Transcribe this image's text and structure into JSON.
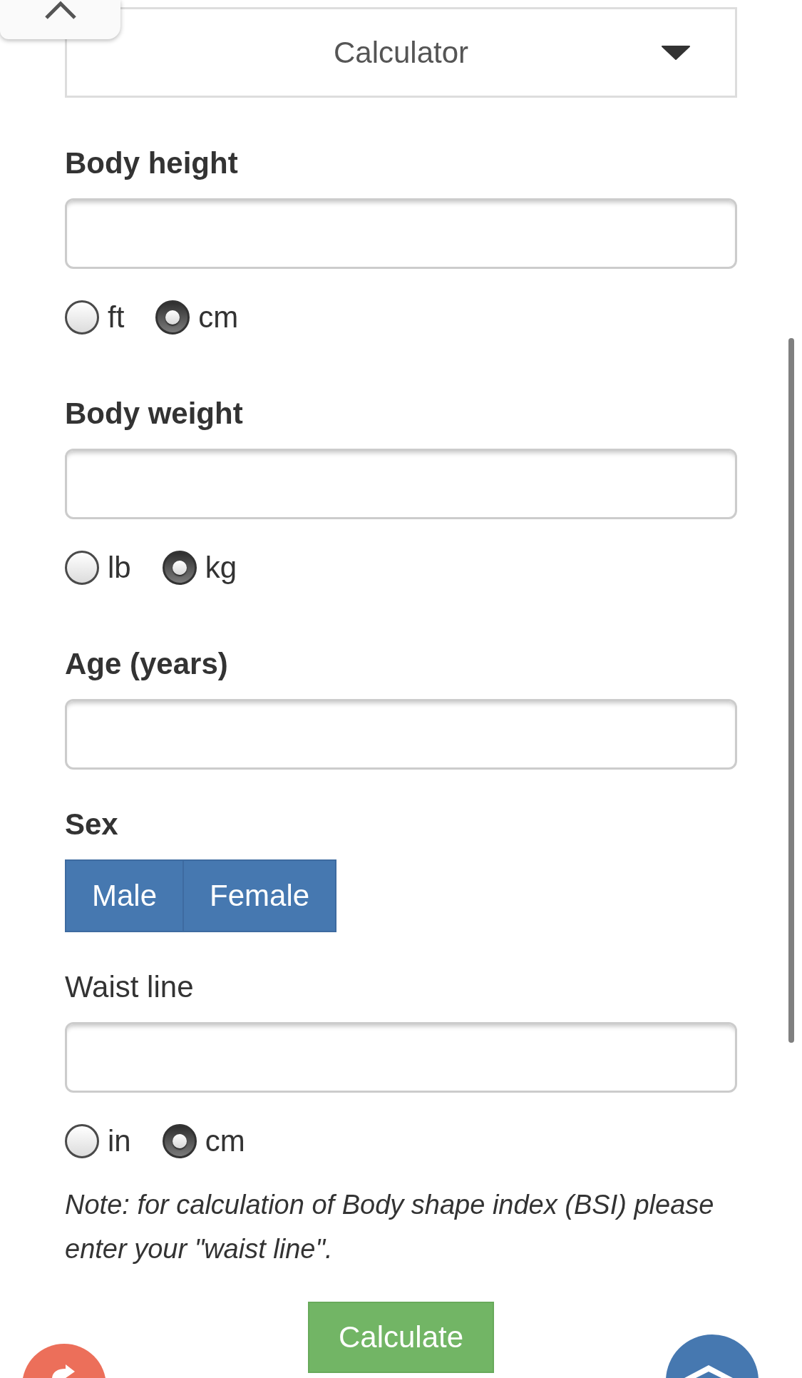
{
  "dropdown": {
    "value": "Calculator"
  },
  "fields": [
    {
      "kind": "number",
      "label": "Body height",
      "optional": false,
      "units": [
        {
          "label": "ft",
          "selected": false
        },
        {
          "label": "cm",
          "selected": true
        }
      ]
    },
    {
      "kind": "number",
      "label": "Body weight",
      "optional": false,
      "units": [
        {
          "label": "lb",
          "selected": false
        },
        {
          "label": "kg",
          "selected": true
        }
      ]
    },
    {
      "kind": "number",
      "label": "Age (years)",
      "optional": false
    },
    {
      "kind": "choice",
      "label": "Sex",
      "optional": false,
      "options": [
        {
          "label": "Male",
          "selected": false
        },
        {
          "label": "Female",
          "selected": false
        }
      ]
    },
    {
      "kind": "number",
      "label": "Waist line",
      "optional": true,
      "units": [
        {
          "label": "in",
          "selected": false
        },
        {
          "label": "cm",
          "selected": true
        }
      ]
    }
  ],
  "note": "Note: for calculation of Body shape index (BSI) please enter your \"waist line\".",
  "calculate_button": {
    "label": "Calculate"
  }
}
